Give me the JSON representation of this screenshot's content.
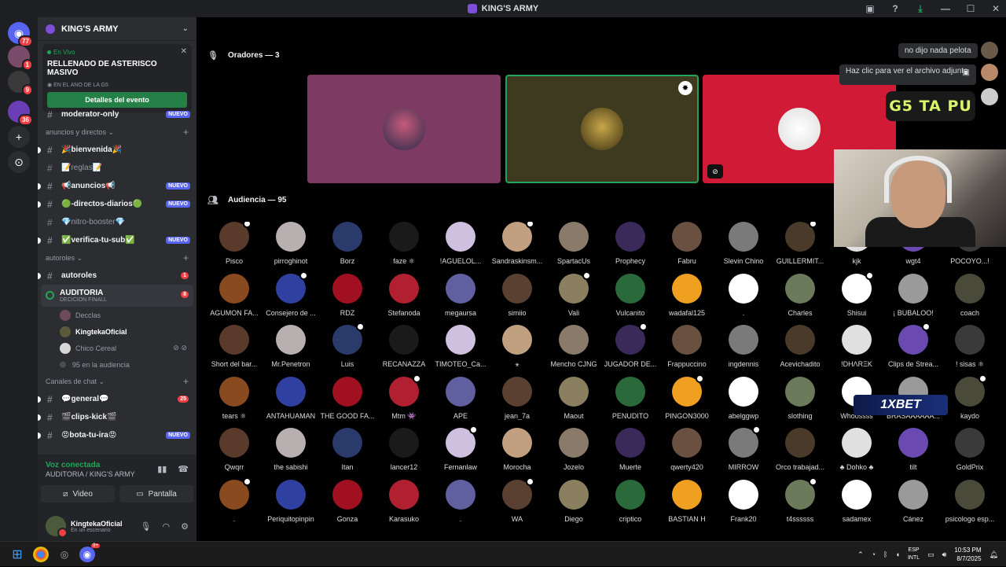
{
  "window": {
    "title": "KING'S ARMY"
  },
  "rail": {
    "servers": [
      {
        "name": "home",
        "badge": "77",
        "color": "#5865f2"
      },
      {
        "name": "server-1",
        "badge": "1",
        "color": "#7a4b6a"
      },
      {
        "name": "server-2",
        "badge": "9",
        "color": "#3a3a3a"
      },
      {
        "name": "kings-army",
        "badge": "36",
        "color": "#6a3fb5"
      },
      {
        "name": "add-server",
        "badge": "",
        "color": "#2b2d31"
      },
      {
        "name": "explore",
        "badge": "",
        "color": "#2b2d31"
      }
    ]
  },
  "sidebar": {
    "server_name": "KING'S ARMY",
    "event": {
      "status": "En Vivo",
      "name": "RELLENADO DE ASTERISCO MASIVO",
      "location": "EN EL ANO DE LA G5",
      "button": "Detalles del evento"
    },
    "channels_top": [
      {
        "name": "moderator-only",
        "tag": "NUEVO"
      }
    ],
    "cat1": "anuncios y directos",
    "channels_a": [
      {
        "name": "🎉bienvenida🎉",
        "tag": ""
      },
      {
        "name": "📝reglas📝",
        "tag": ""
      },
      {
        "name": "📢anuncios📢",
        "tag": "NUEVO"
      },
      {
        "name": "🟢-directos-diarios🟢",
        "tag": "NUEVO"
      },
      {
        "name": "💎nitro-booster💎",
        "tag": ""
      },
      {
        "name": "✅verifica-tu-sub✅",
        "tag": "NUEVO"
      }
    ],
    "cat2": "autoroles",
    "autoroles": {
      "name": "autoroles",
      "count": "1"
    },
    "stage": {
      "name": "AUDITORIA",
      "sub": "DECICION FINALL",
      "count": "8"
    },
    "stage_members": [
      {
        "name": "Decclas"
      },
      {
        "name": "KingtekaOficial"
      },
      {
        "name": "Chico Cereal"
      },
      {
        "name": "95 en la audiencia"
      }
    ],
    "cat3": "Canales de chat",
    "channels_b": [
      {
        "name": "💬general💬",
        "tag": "25"
      },
      {
        "name": "🎬clips-kick🎬",
        "tag": ""
      },
      {
        "name": "😡bota-tu-ira😡",
        "tag": "NUEVO"
      }
    ]
  },
  "voice": {
    "status": "Voz conectada",
    "location": "AUDITORIA / KING'S ARMY",
    "video": "Video",
    "screen": "Pantalla"
  },
  "user": {
    "name": "KingtekaOficial",
    "status": "En un escenario"
  },
  "stage": {
    "speakers_label": "Oradores — 3",
    "audience_label": "Audiencia — 95"
  },
  "audience": [
    "Pisco",
    "pirroghinot",
    "Borz",
    "faze ⚛",
    "!AGUELOL...",
    "Sandraskinsm...",
    "SpartacUs",
    "Prophecy",
    "Fabru",
    "Slevin Chino",
    "GUILLERMIT...",
    "kjk",
    "wgt4",
    "POCOYO...!",
    "AGUMON FA...",
    "Consejero de ...",
    "RDZ",
    "Stefanoda",
    "megaursa",
    "simiio",
    "Vali",
    "Vulcanito",
    "wadafal125",
    ".",
    "Charles",
    "Shisui",
    "¡ BUBALOO!",
    "coach",
    "Short del bar...",
    "Mr.Penetron",
    "Luis",
    "RECANAZZA",
    "TIMOTEO_Ca...",
    "⚹",
    "Mencho CJNG",
    "JUGADOR DE...",
    "Frappuccino",
    "ingdennis",
    "Acevichadito",
    "!DHΛRΞK",
    "Clips de Strea...",
    "! sisas ⚛",
    "tears ⚛",
    "ANTAHUAMAN",
    "THE GOOD FA...",
    "Mtm 👾",
    "APE",
    "jean_7a",
    "Maout",
    "PENUDITO",
    "PINGON3000",
    "abelggwp",
    "slothing",
    "Whoossss",
    "BRASAAAAAA...",
    "kaydo",
    "Qwqrr",
    "the sabishi",
    "Itan",
    "lancer12",
    "Fernanlaw",
    "Morocha",
    "Jozelo",
    "Muerte",
    "qwerty420",
    "MIRROW",
    "Orco trabajad...",
    "♣ Dohko ♣",
    "tilt",
    "GoldPrix",
    ".",
    "Periquitopinpin",
    "Gonza",
    "Karasuko",
    ".",
    "WA",
    "Diego",
    "criptico",
    "BASTIAN H",
    "Frank20",
    "t4ssssss",
    "sadamex",
    "Cánez",
    "psicologo esp..."
  ],
  "overlays": {
    "msg1": "no dijo nada pelota",
    "msg2": "Haz clic para ver el archivo adjunto",
    "brand": "G5 TA PU",
    "sponsor": "1XBET"
  },
  "taskbar": {
    "lang1": "ESP",
    "lang2": "INTL",
    "time": "10:53 PM",
    "date": "8/7/2025",
    "discord_badge": "9+"
  }
}
